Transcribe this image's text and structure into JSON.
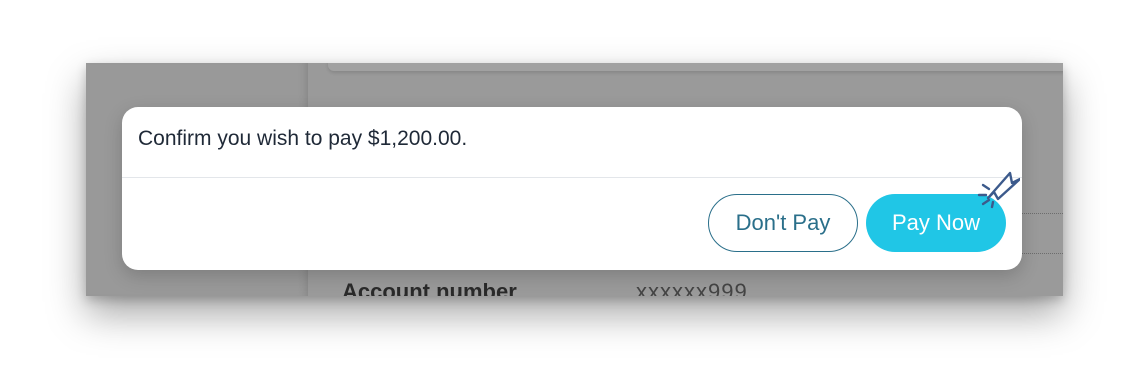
{
  "modal": {
    "message": "Confirm you wish to pay $1,200.00.",
    "dont_pay_label": "Don't Pay",
    "pay_now_label": "Pay Now"
  },
  "background": {
    "field_label": "Account number",
    "field_value": "xxxxxx999"
  },
  "icons": {
    "cursor": "click-cursor-icon"
  },
  "colors": {
    "overlay": "#9a9a9a",
    "primary_button": "#20c6e6",
    "secondary_button_border": "#2a6f8a",
    "text": "#1f2937"
  }
}
